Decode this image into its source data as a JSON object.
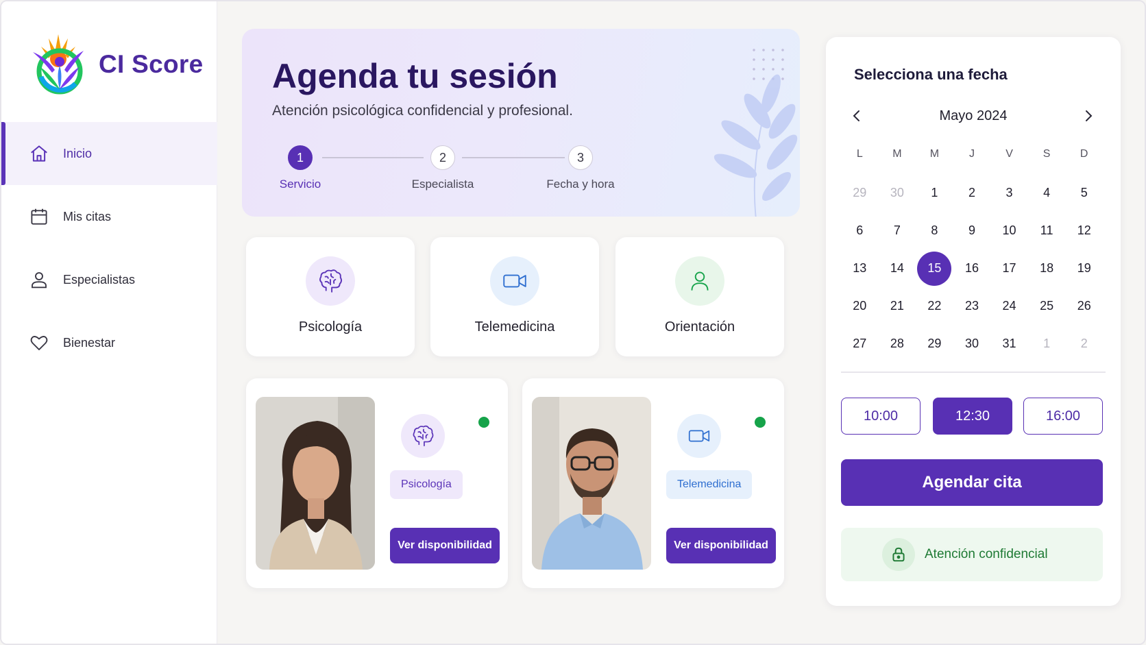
{
  "app": {
    "name": "CI Score"
  },
  "sidebar": {
    "items": [
      {
        "label": "Inicio",
        "icon": "home-icon",
        "active": true
      },
      {
        "label": "Mis citas",
        "icon": "calendar-icon",
        "active": false
      },
      {
        "label": "Especialistas",
        "icon": "user-icon",
        "active": false
      },
      {
        "label": "Bienestar",
        "icon": "heart-icon",
        "active": false
      }
    ]
  },
  "hero": {
    "title": "Agenda tu sesión",
    "subtitle": "Atención psicológica confidencial y profesional.",
    "steps": [
      {
        "number": "1",
        "label": "Servicio",
        "active": true
      },
      {
        "number": "2",
        "label": "Especialista",
        "active": false
      },
      {
        "number": "3",
        "label": "Fecha y hora",
        "active": false
      }
    ]
  },
  "services": [
    {
      "label": "Psicología",
      "icon": "brain-icon"
    },
    {
      "label": "Telemedicina",
      "icon": "video-camera-icon"
    },
    {
      "label": "Orientación",
      "icon": "person-icon"
    }
  ],
  "specialists": [
    {
      "tag": "Psicología",
      "icon": "brain-icon",
      "status": "online",
      "button": "Ver disponibilidad"
    },
    {
      "tag": "Telemedicina",
      "icon": "video-camera-icon",
      "status": "online",
      "button": "Ver disponibilidad"
    }
  ],
  "calendar": {
    "title": "Selecciona una fecha",
    "month": "Mayo 2024",
    "weekdays": [
      "L",
      "M",
      "M",
      "J",
      "V",
      "S",
      "D"
    ],
    "days": [
      "29",
      "30",
      "1",
      "2",
      "3",
      "4",
      "5",
      "6",
      "7",
      "8",
      "9",
      "10",
      "11",
      "12",
      "13",
      "14",
      "15",
      "16",
      "17",
      "18",
      "19",
      "20",
      "21",
      "22",
      "23",
      "24",
      "25",
      "26",
      "27",
      "28",
      "29",
      "30",
      "31",
      "1",
      "2"
    ],
    "muted_days_index": [
      0,
      1,
      33,
      34
    ],
    "selected_day": "15",
    "time_slots": [
      {
        "label": "10:00",
        "selected": false
      },
      {
        "label": "12:30",
        "selected": true
      },
      {
        "label": "16:00",
        "selected": false
      }
    ],
    "book_button": "Agendar cita",
    "confidential_note": "Atención confidencial"
  },
  "colors": {
    "primary": "#5830b4",
    "brand_text": "#4b2a9e",
    "online": "#16a34a",
    "confidential": "#1e7a34"
  }
}
